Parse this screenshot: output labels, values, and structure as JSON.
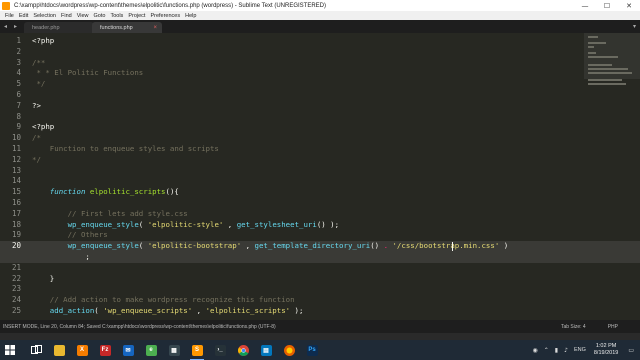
{
  "window": {
    "title": "C:\\xampp\\htdocs\\wordpress\\wp-content\\themes\\elpolitic\\functions.php (wordpress) - Sublime Text (UNREGISTERED)",
    "controls": {
      "minimize": "—",
      "maximize": "☐",
      "close": "✕"
    }
  },
  "menu": [
    "File",
    "Edit",
    "Selection",
    "Find",
    "View",
    "Goto",
    "Tools",
    "Project",
    "Preferences",
    "Help"
  ],
  "tabs": [
    {
      "label": "header.php",
      "active": false
    },
    {
      "label": "functions.php",
      "active": true,
      "close": "×"
    }
  ],
  "editor": {
    "current_line": 20,
    "lines": [
      {
        "n": "1",
        "tokens": [
          [
            "php",
            "<?php"
          ]
        ]
      },
      {
        "n": "2",
        "tokens": []
      },
      {
        "n": "3",
        "tokens": [
          [
            "cmt",
            "/**"
          ]
        ]
      },
      {
        "n": "4",
        "tokens": [
          [
            "cmt",
            " * * El Politic Functions"
          ]
        ]
      },
      {
        "n": "5",
        "tokens": [
          [
            "cmt",
            " */"
          ]
        ]
      },
      {
        "n": "6",
        "tokens": []
      },
      {
        "n": "7",
        "tokens": [
          [
            "php",
            "?>"
          ]
        ]
      },
      {
        "n": "8",
        "tokens": []
      },
      {
        "n": "9",
        "tokens": [
          [
            "php",
            "<?php"
          ]
        ]
      },
      {
        "n": "10",
        "tokens": [
          [
            "cmt",
            "/*"
          ]
        ]
      },
      {
        "n": "11",
        "tokens": [
          [
            "cmt",
            "    Function to enqueue styles and scripts"
          ]
        ]
      },
      {
        "n": "12",
        "tokens": [
          [
            "cmt",
            "*/"
          ]
        ]
      },
      {
        "n": "13",
        "tokens": []
      },
      {
        "n": "14",
        "tokens": []
      },
      {
        "n": "15",
        "tokens": [
          [
            "kw",
            "    function "
          ],
          [
            "fn",
            "elpolitic_scripts"
          ],
          [
            "punc",
            "(){"
          ]
        ]
      },
      {
        "n": "16",
        "tokens": []
      },
      {
        "n": "17",
        "tokens": [
          [
            "cmt",
            "        // First lets add style.css"
          ]
        ]
      },
      {
        "n": "18",
        "tokens": [
          [
            "call",
            "        wp_enqueue_style"
          ],
          [
            "punc",
            "( "
          ],
          [
            "str",
            "'elpolitic-style'"
          ],
          [
            "punc",
            " , "
          ],
          [
            "call",
            "get_stylesheet_uri"
          ],
          [
            "punc",
            "() );"
          ]
        ]
      },
      {
        "n": "19",
        "tokens": [
          [
            "cmt",
            "        // Others"
          ]
        ]
      },
      {
        "n": "20",
        "tokens": [
          [
            "call",
            "        wp_enqueue_style"
          ],
          [
            "punc",
            "( "
          ],
          [
            "str",
            "'elpolitic-bootstrap'"
          ],
          [
            "punc",
            " , "
          ],
          [
            "call",
            "get_template_directory_uri"
          ],
          [
            "punc",
            "() "
          ],
          [
            "op",
            "."
          ],
          [
            "punc",
            " "
          ],
          [
            "str",
            "'/css/bootstrap.min.css'"
          ],
          [
            "punc",
            " )"
          ]
        ]
      },
      {
        "n": "",
        "tokens": [
          [
            "punc",
            "            ;"
          ]
        ]
      },
      {
        "n": "21",
        "tokens": []
      },
      {
        "n": "22",
        "tokens": [
          [
            "punc",
            "    }"
          ]
        ]
      },
      {
        "n": "23",
        "tokens": []
      },
      {
        "n": "24",
        "tokens": [
          [
            "cmt",
            "    // Add action to make wordpress recognize this function"
          ]
        ]
      },
      {
        "n": "25",
        "tokens": [
          [
            "call",
            "    add_action"
          ],
          [
            "punc",
            "( "
          ],
          [
            "str",
            "'wp_enqueue_scripts'"
          ],
          [
            "punc",
            " , "
          ],
          [
            "str",
            "'elpolitic_scripts'"
          ],
          [
            "punc",
            " );"
          ]
        ]
      }
    ]
  },
  "status": {
    "left": "INSERT MODE, Line 20, Column 84; Saved C:\\xampp\\htdocs\\wordpress\\wp-content\\themes\\elpolitic\\functions.php (UTF-8)",
    "tab_size": "Tab Size: 4",
    "syntax": "PHP"
  },
  "taskbar": {
    "language": "ENG",
    "time": "1:02 PM",
    "date": "8/19/2019"
  },
  "colors": {
    "editor_bg": "#272822",
    "comment": "#75715e",
    "string": "#e6db74",
    "function": "#a6e22e",
    "keyword": "#66d9ef",
    "operator": "#f92672"
  }
}
